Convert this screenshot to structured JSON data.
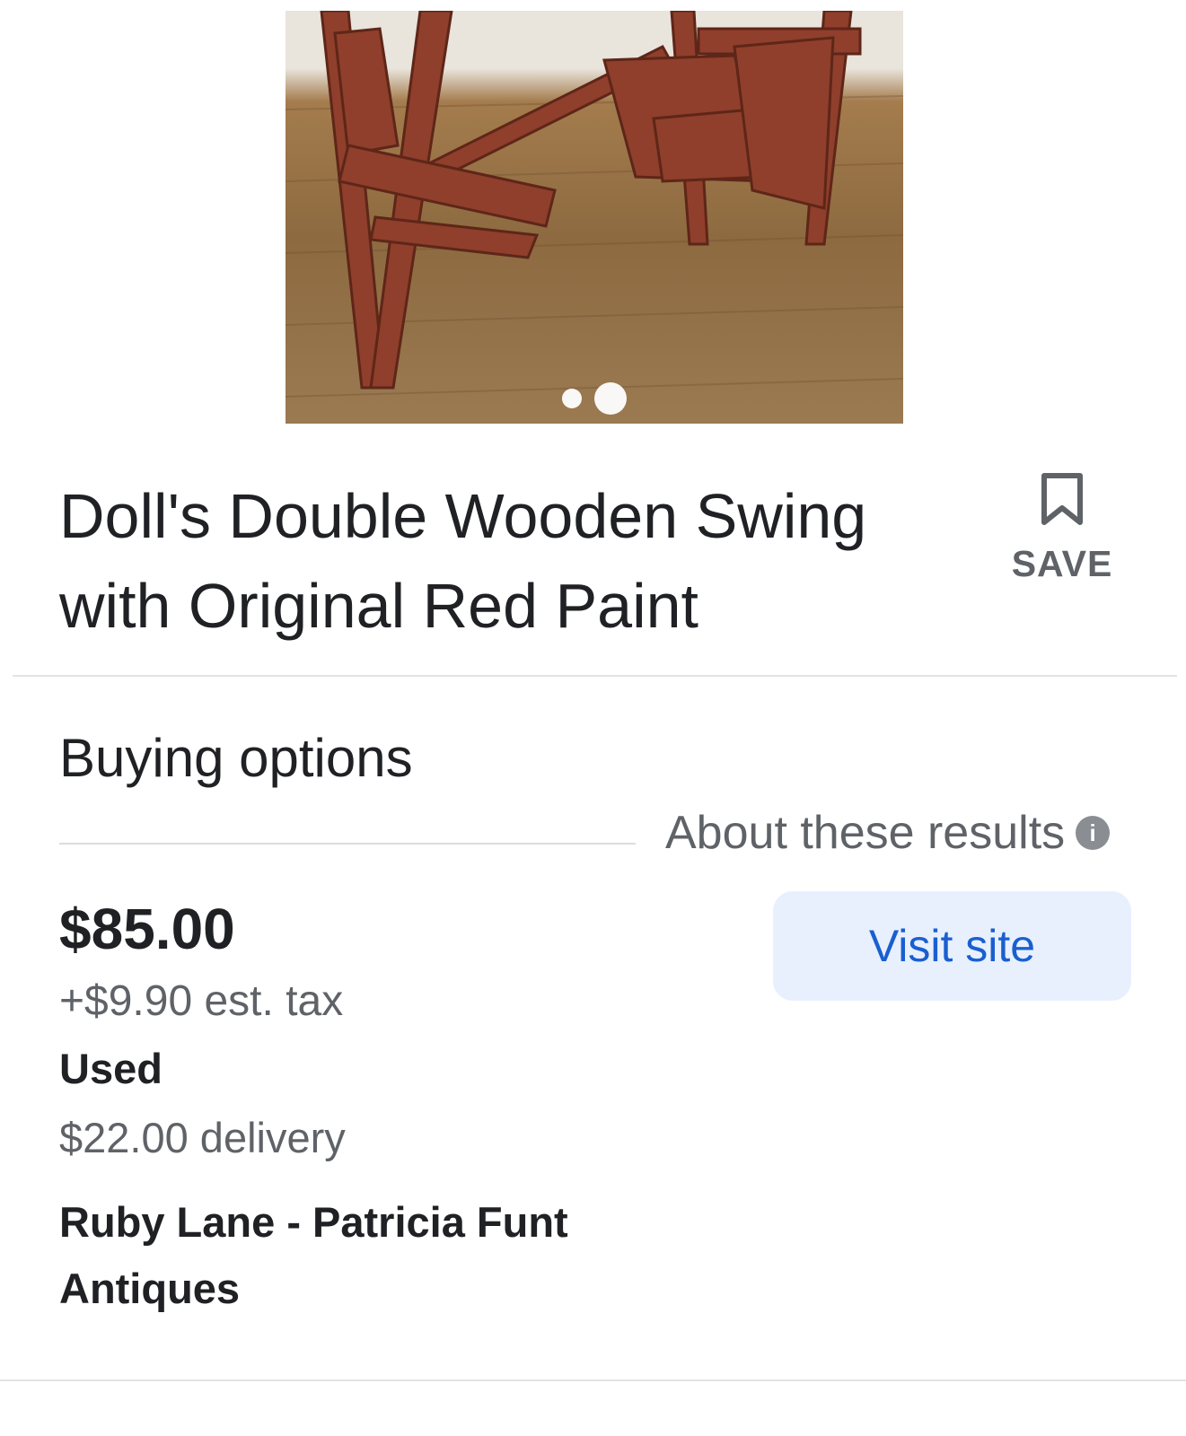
{
  "product": {
    "title": "Doll's Double Wooden Swing with Original Red Paint",
    "image_alt": "Doll's double wooden swing",
    "carousel": {
      "count": 2,
      "active_index": 1
    }
  },
  "save": {
    "label": "SAVE",
    "icon": "bookmark-icon"
  },
  "buying_options": {
    "heading": "Buying options",
    "about_label": "About these results",
    "about_icon": "info-icon"
  },
  "offer": {
    "price": "$85.00",
    "tax": "+$9.90 est. tax",
    "condition": "Used",
    "delivery": "$22.00 delivery",
    "seller": "Ruby Lane - Patricia Funt Antiques",
    "cta_label": "Visit site"
  },
  "colors": {
    "accent": "#1a5fd0",
    "cta_bg": "#e8f0fe",
    "muted": "#5f6368",
    "text": "#202124"
  }
}
